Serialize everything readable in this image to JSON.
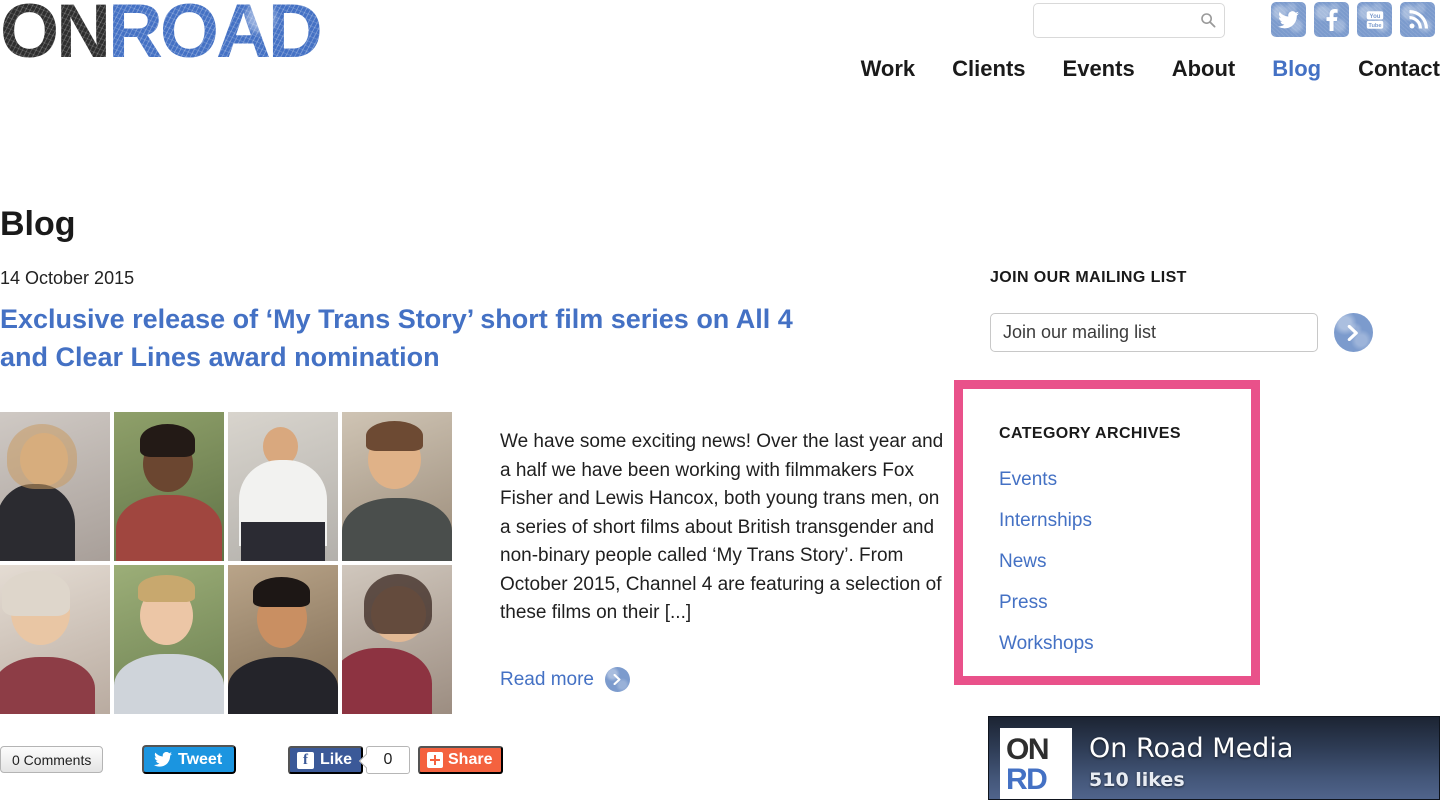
{
  "header": {
    "logo": {
      "part1": "ON",
      "part2": "ROAD",
      "color1": "#2e2e2e",
      "color2": "#4471c4"
    },
    "search": {
      "value": "",
      "placeholder": "",
      "icon": "search-icon"
    },
    "socials": [
      {
        "name": "twitter",
        "label": "Twitter"
      },
      {
        "name": "facebook",
        "label": "Facebook"
      },
      {
        "name": "youtube",
        "label": "YouTube"
      },
      {
        "name": "rss",
        "label": "RSS"
      }
    ],
    "nav": [
      {
        "label": "Work",
        "active": false
      },
      {
        "label": "Clients",
        "active": false
      },
      {
        "label": "Events",
        "active": false
      },
      {
        "label": "About",
        "active": false
      },
      {
        "label": "Blog",
        "active": true
      },
      {
        "label": "Contact",
        "active": false
      }
    ]
  },
  "main": {
    "page_title": "Blog",
    "post": {
      "date": "14 October 2015",
      "title": "Exclusive release of ‘My Trans Story’ short film series on All 4 and Clear Lines award nomination",
      "excerpt": "We have some exciting news! Over the last year and a half we have been working with filmmakers Fox Fisher and Lewis Hancox, both young trans men, on a series of short films about British transgender and non-binary people called ‘My Trans Story’. From October 2015, Channel 4 are featuring a selection of these films on their [...]",
      "read_more": "Read more",
      "thumbnail_alt": "Grid of eight portrait photos of people featured in My Trans Story"
    },
    "share_bar": {
      "comments_label": "0 Comments",
      "tweet_label": "Tweet",
      "like_label": "Like",
      "like_count": "0",
      "share_label": "Share"
    }
  },
  "sidebar": {
    "mailing_list": {
      "heading": "JOIN OUR MAILING LIST",
      "input_value": "",
      "input_placeholder": "Join our mailing list",
      "submit_icon": "chevron-right-icon"
    },
    "category_archives": {
      "heading": "CATEGORY ARCHIVES",
      "highlight_color": "#e9518a",
      "items": [
        {
          "label": "Events"
        },
        {
          "label": "Internships"
        },
        {
          "label": "News"
        },
        {
          "label": "Press"
        },
        {
          "label": "Workshops"
        }
      ]
    },
    "facebook_widget": {
      "page_name": "On Road Media",
      "likes": "510 likes",
      "logo_line1": "ON",
      "logo_line2": "RD"
    }
  },
  "theme": {
    "link_blue": "#4471c4",
    "pink": "#e9518a",
    "twitter_blue": "#1b95e0",
    "facebook_blue": "#3b5998",
    "share_orange": "#f4623f"
  }
}
